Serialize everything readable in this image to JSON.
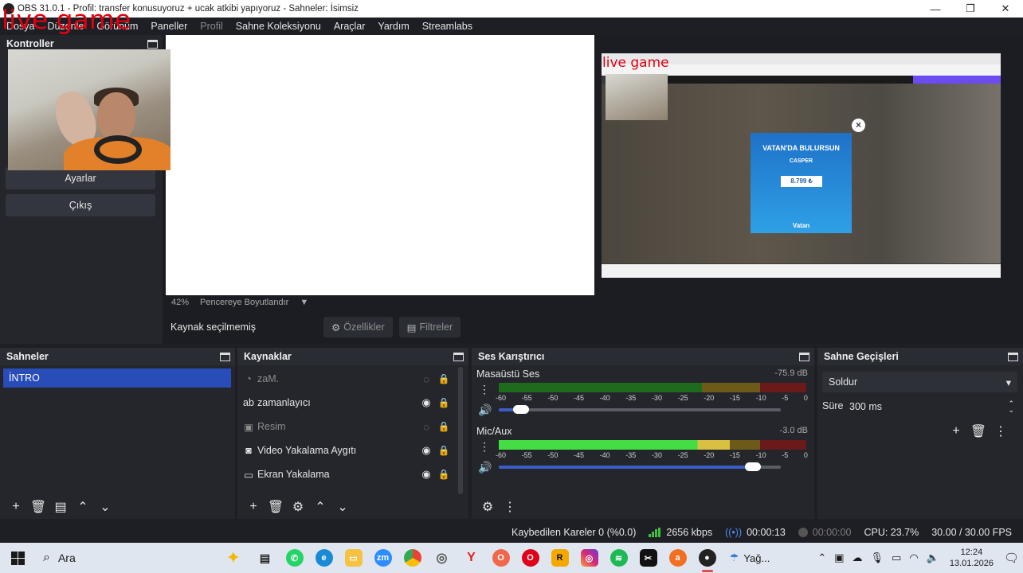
{
  "window": {
    "title": "OBS 31.0.1 - Profil: transfer  konusuyoruz + ucak atkibi yapıyoruz - Sahneler: İsimsiz",
    "minimize": "—",
    "maximize": "❐",
    "close": "✕"
  },
  "overlay_text": "live game",
  "menu": [
    "Dosya",
    "Düzenle",
    "Görünüm",
    "Paneller",
    "Profil",
    "Sahne Koleksiyonu",
    "Araçlar",
    "Yardım",
    "Streamlabs"
  ],
  "controls": {
    "title": "Kontroller",
    "buttons": [
      "Ayarlar",
      "Çıkış"
    ]
  },
  "preview": {
    "zoom": "42%",
    "resize": "Pencereye Boyutlandır",
    "program_overlay_text": "live game",
    "ad": {
      "line1": "VATAN'DA BULURSUN",
      "line2": "CASPER",
      "price": "8.799 ₺",
      "brand": "Vatan"
    }
  },
  "source_toolbar": {
    "no_selection": "Kaynak seçilmemiş",
    "properties": "Özellikler",
    "filters": "Filtreler"
  },
  "scenes": {
    "title": "Sahneler",
    "items": [
      "İNTRO"
    ]
  },
  "sources": {
    "title": "Kaynaklar",
    "items": [
      {
        "name": "zaM.",
        "visible": false
      },
      {
        "name": "zamanlayıcı",
        "visible": true
      },
      {
        "name": "Resim",
        "visible": false
      },
      {
        "name": "Video Yakalama Aygıtı",
        "visible": true
      },
      {
        "name": "Ekran Yakalama",
        "visible": true
      }
    ]
  },
  "mixer": {
    "title": "Ses Karıştırıcı",
    "scale": [
      "-60",
      "-55",
      "-50",
      "-45",
      "-40",
      "-35",
      "-30",
      "-25",
      "-20",
      "-15",
      "-10",
      "-5",
      "0"
    ],
    "channels": [
      {
        "name": "Masaüstü Ses",
        "db": "-75.9 dB",
        "level": 0,
        "volume": 0.08
      },
      {
        "name": "Mic/Aux",
        "db": "-3.0 dB",
        "level": 0.75,
        "volume": 0.9
      }
    ]
  },
  "transitions": {
    "title": "Sahne Geçişleri",
    "selected": "Soldur",
    "duration_label": "Süre",
    "duration": "300 ms"
  },
  "status": {
    "dropped": "Kaybedilen Kareler 0 (%0.0)",
    "bitrate": "2656 kbps",
    "stream_time": "00:00:13",
    "record_time": "00:00:00",
    "cpu": "CPU: 23.7%",
    "fps": "30.00 / 30.00 FPS"
  },
  "taskbar": {
    "search": "Ara",
    "weather": "Yağ...",
    "time": "12:24",
    "date": "13.01.2026"
  }
}
